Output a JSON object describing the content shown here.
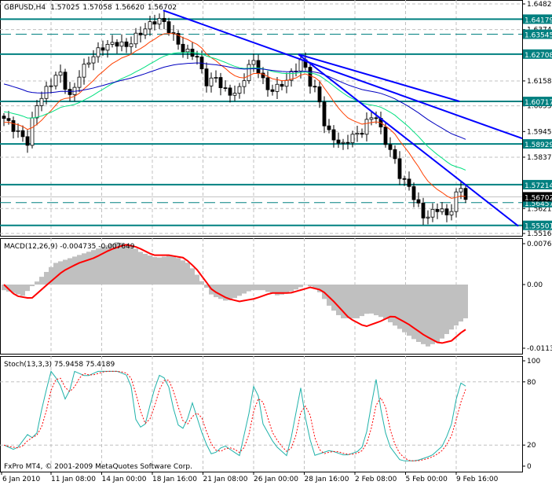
{
  "header": {
    "symbol": "GBPUSD,H4",
    "open": "1.57025",
    "high": "1.57058",
    "low": "1.56620",
    "close": "1.56702"
  },
  "macd": {
    "title": "MACD(12,26,9) -0.004735 -0.007649",
    "ticks": [
      "0.00766",
      "0.00",
      "-0.01132"
    ],
    "tick_values": [
      0.00766,
      0,
      -0.01132
    ]
  },
  "stoch": {
    "title": "Stoch(13,3,3) 75.9458 75.4189",
    "ticks": [
      "100",
      "80",
      "20",
      "0"
    ],
    "tick_values": [
      100,
      80,
      20,
      0
    ]
  },
  "copyright": "FxPro MT4, © 2001-2009 MetaQuotes Software Corp.",
  "price_axis": {
    "ticks": [
      "1.64820",
      "1.63740",
      "1.61580",
      "1.60530",
      "1.59450",
      "1.58370",
      "1.56210",
      "1.55160"
    ],
    "tick_values": [
      1.6482,
      1.6374,
      1.6158,
      1.6053,
      1.5945,
      1.5837,
      1.5621,
      1.5516
    ],
    "current": "1.56702",
    "current_value": 1.56702
  },
  "levels": [
    {
      "label": "1.64179",
      "value": 1.64179,
      "style": "solid"
    },
    {
      "label": "1.63545",
      "value": 1.63545,
      "style": "dashed"
    },
    {
      "label": "1.62708",
      "value": 1.62708,
      "style": "solid"
    },
    {
      "label": "1.60717",
      "value": 1.60717,
      "style": "solid"
    },
    {
      "label": "1.58929",
      "value": 1.58929,
      "style": "solid"
    },
    {
      "label": "1.57214",
      "value": 1.57214,
      "style": "solid"
    },
    {
      "label": "1.56457",
      "value": 1.56457,
      "style": "dashed"
    },
    {
      "label": "1.55501",
      "value": 1.55501,
      "style": "solid"
    }
  ],
  "time_axis": [
    "6 Jan 2010",
    "11 Jan 08:00",
    "14 Jan 00:00",
    "18 Jan 16:00",
    "21 Jan 08:00",
    "26 Jan 00:00",
    "28 Jan 16:00",
    "2 Feb 08:00",
    "5 Feb 00:00",
    "9 Feb 16:00"
  ],
  "colors": {
    "level": "#008080",
    "trend": "#0000ff",
    "ma_fast": "#ff4000",
    "ma_mid": "#00e080",
    "ma_slow": "#0000c0",
    "macd_hist": "#c0c0c0",
    "macd_signal": "#ff0000",
    "stoch_main": "#20b2aa",
    "stoch_signal": "#ff0000"
  },
  "chart_data": {
    "type": "candlestick",
    "close_keypoints": [
      [
        0,
        1.6
      ],
      [
        2.5,
        1.595
      ],
      [
        5,
        1.59
      ],
      [
        6.7,
        1.605
      ],
      [
        8.3,
        1.61
      ],
      [
        10,
        1.615
      ],
      [
        11.7,
        1.62
      ],
      [
        14.2,
        1.608
      ],
      [
        15.8,
        1.618
      ],
      [
        18.3,
        1.625
      ],
      [
        20.8,
        1.63
      ],
      [
        24.2,
        1.632
      ],
      [
        25.8,
        1.63
      ],
      [
        28.3,
        1.635
      ],
      [
        32.5,
        1.642
      ],
      [
        34.2,
        1.64
      ],
      [
        35.8,
        1.635
      ],
      [
        38.3,
        1.628
      ],
      [
        40.8,
        1.627
      ],
      [
        42.8,
        1.615
      ],
      [
        45,
        1.617
      ],
      [
        47.5,
        1.61
      ],
      [
        50,
        1.612
      ],
      [
        52.5,
        1.625
      ],
      [
        54.2,
        1.62
      ],
      [
        55.8,
        1.612
      ],
      [
        58.3,
        1.613
      ],
      [
        60.8,
        1.618
      ],
      [
        63.3,
        1.625
      ],
      [
        65,
        1.615
      ],
      [
        66.7,
        1.61
      ],
      [
        68.3,
        1.595
      ],
      [
        70,
        1.592
      ],
      [
        71.7,
        1.588
      ],
      [
        73.3,
        1.592
      ],
      [
        75.8,
        1.594
      ],
      [
        77.5,
        1.6
      ],
      [
        78.8,
        1.602
      ],
      [
        80.5,
        1.592
      ],
      [
        82.5,
        1.585
      ],
      [
        84.2,
        1.575
      ],
      [
        85.8,
        1.572
      ],
      [
        87.5,
        1.565
      ],
      [
        89.2,
        1.558
      ],
      [
        90.8,
        1.56
      ],
      [
        92.5,
        1.563
      ],
      [
        94.2,
        1.558
      ],
      [
        95.5,
        1.565
      ],
      [
        96.7,
        1.572
      ],
      [
        97.8,
        1.567
      ]
    ],
    "macd_hist_keypoints": [
      [
        0,
        -1
      ],
      [
        4,
        -2
      ],
      [
        7.5,
        1
      ],
      [
        10.8,
        4
      ],
      [
        14.2,
        5
      ],
      [
        17.5,
        6
      ],
      [
        20.8,
        7
      ],
      [
        24.2,
        8
      ],
      [
        26.7,
        7.5
      ],
      [
        29.2,
        6
      ],
      [
        32.5,
        5
      ],
      [
        35.8,
        5.5
      ],
      [
        39.2,
        4
      ],
      [
        41.7,
        1
      ],
      [
        44.2,
        -2
      ],
      [
        47.5,
        -3
      ],
      [
        50,
        -2
      ],
      [
        52.5,
        -1
      ],
      [
        55,
        -1
      ],
      [
        58.3,
        -2
      ],
      [
        61.7,
        -1
      ],
      [
        64.2,
        0
      ],
      [
        66.7,
        -1
      ],
      [
        69.2,
        -4
      ],
      [
        71.7,
        -6
      ],
      [
        75,
        -6
      ],
      [
        77.5,
        -5
      ],
      [
        80.8,
        -6
      ],
      [
        84.2,
        -8
      ],
      [
        87.5,
        -10
      ],
      [
        90,
        -11
      ],
      [
        92.5,
        -10
      ],
      [
        95,
        -8
      ],
      [
        97.8,
        -6
      ]
    ],
    "macd_signal_keypoints": [
      [
        0,
        0
      ],
      [
        2.5,
        -2
      ],
      [
        5.8,
        -2.5
      ],
      [
        9.2,
        0
      ],
      [
        12.5,
        2.5
      ],
      [
        15.8,
        4
      ],
      [
        19.2,
        5
      ],
      [
        22.5,
        6.5
      ],
      [
        25.8,
        7.5
      ],
      [
        28.3,
        7
      ],
      [
        31.7,
        5.5
      ],
      [
        35,
        5.5
      ],
      [
        38.3,
        5
      ],
      [
        40.8,
        3
      ],
      [
        44.2,
        -1
      ],
      [
        47.5,
        -2.5
      ],
      [
        50,
        -3
      ],
      [
        53.3,
        -2.5
      ],
      [
        56.7,
        -1.5
      ],
      [
        60.8,
        -1.5
      ],
      [
        65,
        -0.5
      ],
      [
        67.5,
        -1
      ],
      [
        70,
        -3
      ],
      [
        73.3,
        -6
      ],
      [
        76.7,
        -7.5
      ],
      [
        80,
        -6.5
      ],
      [
        82.5,
        -5.5
      ],
      [
        85.8,
        -7
      ],
      [
        89.2,
        -9
      ],
      [
        92.5,
        -10.5
      ],
      [
        95,
        -10
      ],
      [
        97.8,
        -8
      ]
    ],
    "macd_unit": 0.001,
    "stoch_keypoints": [
      [
        0,
        20
      ],
      [
        2.5,
        15
      ],
      [
        5,
        30
      ],
      [
        6.7,
        25
      ],
      [
        8.3,
        60
      ],
      [
        10,
        90
      ],
      [
        11.7,
        80
      ],
      [
        13.3,
        60
      ],
      [
        15,
        90
      ],
      [
        17.5,
        85
      ],
      [
        20,
        90
      ],
      [
        24.2,
        90
      ],
      [
        26.7,
        85
      ],
      [
        28.3,
        35
      ],
      [
        30,
        40
      ],
      [
        31.7,
        70
      ],
      [
        33.3,
        90
      ],
      [
        35,
        75
      ],
      [
        36.7,
        40
      ],
      [
        38.3,
        35
      ],
      [
        40,
        60
      ],
      [
        42.5,
        25
      ],
      [
        44.2,
        10
      ],
      [
        46.7,
        20
      ],
      [
        48.3,
        15
      ],
      [
        50,
        10
      ],
      [
        52.5,
        60
      ],
      [
        53.3,
        85
      ],
      [
        55,
        40
      ],
      [
        57.5,
        20
      ],
      [
        60,
        10
      ],
      [
        61.7,
        40
      ],
      [
        62.8,
        80
      ],
      [
        64.2,
        40
      ],
      [
        65.8,
        10
      ],
      [
        69.2,
        15
      ],
      [
        72.5,
        10
      ],
      [
        75.8,
        15
      ],
      [
        77.5,
        40
      ],
      [
        78.8,
        88
      ],
      [
        80.5,
        40
      ],
      [
        81.7,
        20
      ],
      [
        84.2,
        5
      ],
      [
        87.5,
        5
      ],
      [
        90.8,
        10
      ],
      [
        93.3,
        20
      ],
      [
        95,
        40
      ],
      [
        96.7,
        80
      ],
      [
        97.8,
        76
      ]
    ],
    "trendlines": [
      {
        "from": [
          33.8,
          1.6455
        ],
        "to": [
          110,
          1.5916
        ]
      },
      {
        "from": [
          62.5,
          1.627
        ],
        "to": [
          109.2,
          1.5547
        ]
      },
      {
        "from": [
          62.5,
          1.627
        ],
        "to": [
          96.7,
          1.6072
        ]
      }
    ]
  }
}
